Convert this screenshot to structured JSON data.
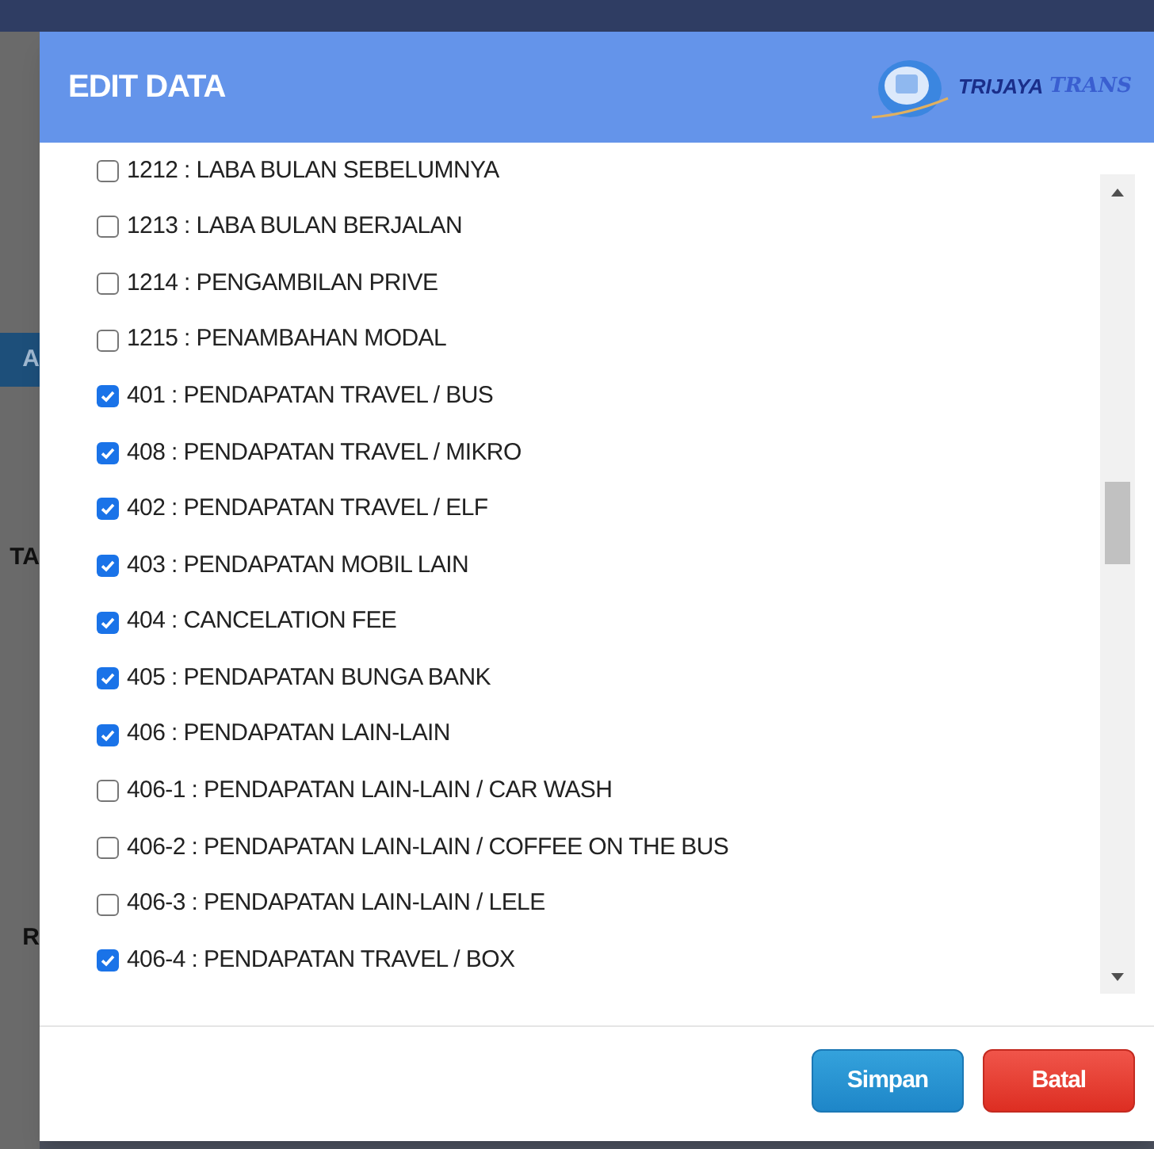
{
  "background": {
    "fragments": [
      {
        "text": "A",
        "kind": "banner"
      },
      {
        "text": "TA",
        "kind": "plain"
      },
      {
        "text": "R",
        "kind": "plain"
      }
    ]
  },
  "modal": {
    "title": "EDIT DATA",
    "logo": {
      "name": "TRIJAYA",
      "suffix": "TRANS"
    },
    "items": [
      {
        "label": "1212 : LABA BULAN SEBELUMNYA",
        "checked": false
      },
      {
        "label": "1213 : LABA BULAN BERJALAN",
        "checked": false
      },
      {
        "label": "1214 : PENGAMBILAN PRIVE",
        "checked": false
      },
      {
        "label": "1215 : PENAMBAHAN MODAL",
        "checked": false
      },
      {
        "label": "401 : PENDAPATAN TRAVEL / BUS",
        "checked": true
      },
      {
        "label": "408 : PENDAPATAN TRAVEL / MIKRO",
        "checked": true
      },
      {
        "label": "402 : PENDAPATAN TRAVEL / ELF",
        "checked": true
      },
      {
        "label": "403 : PENDAPATAN MOBIL LAIN",
        "checked": true
      },
      {
        "label": "404 : CANCELATION FEE",
        "checked": true
      },
      {
        "label": "405 : PENDAPATAN BUNGA BANK",
        "checked": true
      },
      {
        "label": "406 : PENDAPATAN LAIN-LAIN",
        "checked": true
      },
      {
        "label": "406-1 : PENDAPATAN LAIN-LAIN / CAR WASH",
        "checked": false
      },
      {
        "label": "406-2 : PENDAPATAN LAIN-LAIN / COFFEE ON THE BUS",
        "checked": false
      },
      {
        "label": "406-3 : PENDAPATAN LAIN-LAIN / LELE",
        "checked": false
      },
      {
        "label": "406-4 : PENDAPATAN TRAVEL / BOX",
        "checked": true
      }
    ],
    "buttons": [
      {
        "label": "Simpan",
        "kind": "primary"
      },
      {
        "label": "Batal",
        "kind": "danger"
      }
    ]
  }
}
